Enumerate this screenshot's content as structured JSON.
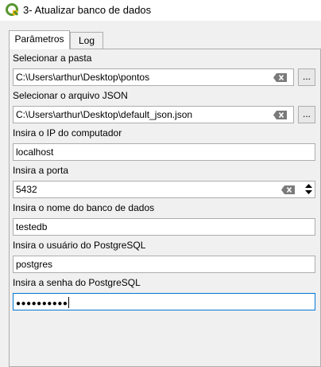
{
  "window": {
    "title": "3- Atualizar banco de dados",
    "icon": "qgis-icon"
  },
  "tabs": [
    {
      "label": "Parâmetros",
      "active": true
    },
    {
      "label": "Log",
      "active": false
    }
  ],
  "form": {
    "folder": {
      "label": "Selecionar a pasta",
      "value": "C:\\Users\\arthur\\Desktop\\pontos",
      "browse_label": "..."
    },
    "json_file": {
      "label": "Selecionar o arquivo JSON",
      "value": "C:\\Users\\arthur\\Desktop\\default_json.json",
      "browse_label": "..."
    },
    "ip": {
      "label": "Insira o IP do computador",
      "value": "localhost"
    },
    "port": {
      "label": "Insira a porta",
      "value": "5432"
    },
    "db_name": {
      "label": "Insira o nome do banco de dados",
      "value": "testedb"
    },
    "user": {
      "label": "Insira o usuário do PostgreSQL",
      "value": "postgres"
    },
    "password": {
      "label": "Insira a senha do PostgreSQL",
      "value": "●●●●●●●●●●"
    }
  },
  "colors": {
    "focus_border": "#0078d7",
    "qgis_green": "#6aa84f",
    "qgis_yellow": "#f0c419"
  }
}
